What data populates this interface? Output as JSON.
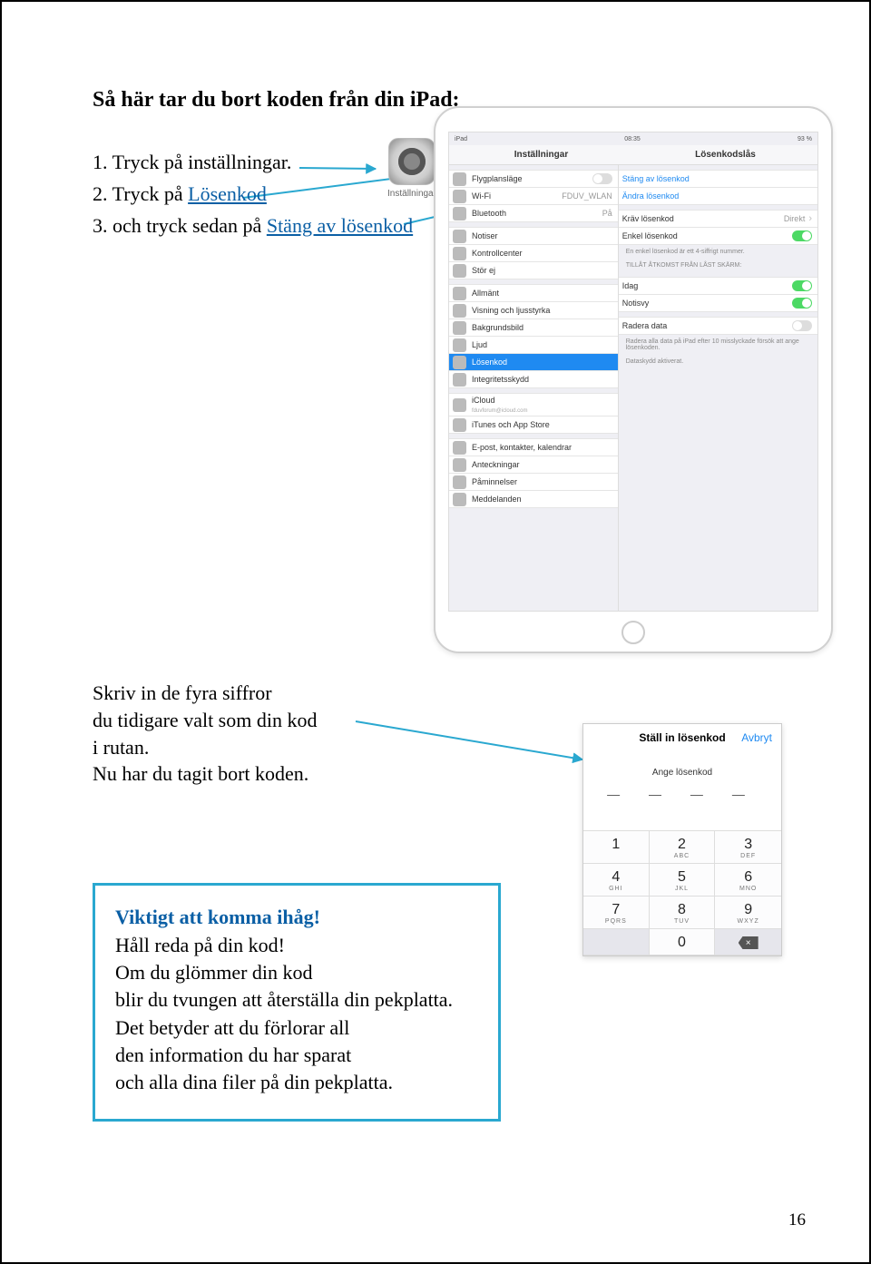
{
  "title": "Så här tar du bort koden från din iPad:",
  "steps": {
    "s1": "1. Tryck på inställningar.",
    "s2_prefix": "2. Tryck på ",
    "s2_link": "Lösenkod",
    "s3_prefix": "3. och tryck sedan på ",
    "s3_link": "Stäng av lösenkod"
  },
  "settings_icon_label": "Inställningar",
  "block2": {
    "l1": "Skriv in de fyra siffror",
    "l2": "du tidigare valt som din kod",
    "l3": "i rutan.",
    "l4": "Nu har du tagit bort koden."
  },
  "important": {
    "hdr": "Viktigt att komma ihåg!",
    "l1": "Håll reda på din kod!",
    "l2": "Om du glömmer din kod",
    "l3": "blir du tvungen att återställa din pekplatta.",
    "l4": "Det betyder att du förlorar all",
    "l5": "den information du har sparat",
    "l6": "och alla dina filer på din pekplatta."
  },
  "page_number": "16",
  "ipad": {
    "status": {
      "left": "iPad",
      "center": "08:35",
      "right": "93 %"
    },
    "titles": {
      "left": "Inställningar",
      "right": "Lösenkodslås"
    },
    "left_col": {
      "g1": [
        {
          "label": "Flygplansläge",
          "icon": "i-orange",
          "switch": "off"
        },
        {
          "label": "Wi-Fi",
          "icon": "i-blue",
          "value": "FDUV_WLAN"
        },
        {
          "label": "Bluetooth",
          "icon": "i-blue",
          "value": "På"
        }
      ],
      "g2": [
        {
          "label": "Notiser",
          "icon": "i-red"
        },
        {
          "label": "Kontrollcenter",
          "icon": "i-gray"
        },
        {
          "label": "Stör ej",
          "icon": "i-purple"
        }
      ],
      "g3": [
        {
          "label": "Allmänt",
          "icon": "i-gray"
        },
        {
          "label": "Visning och ljusstyrka",
          "icon": "i-bluel"
        },
        {
          "label": "Bakgrundsbild",
          "icon": "i-bluel"
        },
        {
          "label": "Ljud",
          "icon": "i-red"
        },
        {
          "label": "Lösenkod",
          "icon": "i-red",
          "selected": true
        },
        {
          "label": "Integritetsskydd",
          "icon": "i-gray"
        }
      ],
      "g4": [
        {
          "label": "iCloud",
          "icon": "i-blue",
          "sub": "fduvforum@icloud.com"
        },
        {
          "label": "iTunes och App Store",
          "icon": "i-blue"
        }
      ],
      "g5": [
        {
          "label": "E-post, kontakter, kalendrar",
          "icon": "i-blue"
        },
        {
          "label": "Anteckningar",
          "icon": "i-orange"
        },
        {
          "label": "Påminnelser",
          "icon": "i-gray"
        },
        {
          "label": "Meddelanden",
          "icon": "i-green"
        }
      ]
    },
    "right_col": {
      "g1": [
        {
          "label": "Stäng av lösenkod",
          "link": true
        },
        {
          "label": "Ändra lösenkod",
          "link": true
        }
      ],
      "g2": [
        {
          "label": "Kräv lösenkod",
          "value": "Direkt",
          "chev": true
        },
        {
          "label": "Enkel lösenkod",
          "switch": "on"
        }
      ],
      "g2_caption": "En enkel lösenkod är ett 4-siffrigt nummer.",
      "section_hdr": "TILLÅT ÅTKOMST FRÅN LÅST SKÄRM:",
      "g3": [
        {
          "label": "Idag",
          "switch": "on"
        },
        {
          "label": "Notisvy",
          "switch": "on"
        }
      ],
      "g4": [
        {
          "label": "Radera data",
          "switch": "off"
        }
      ],
      "g4_caption": "Radera alla data på iPad efter 10 misslyckade försök att ange lösenkoden.",
      "g4_caption2": "Dataskydd aktiverat."
    }
  },
  "dialog": {
    "title": "Ställ in lösenkod",
    "cancel": "Avbryt",
    "prompt": "Ange lösenkod",
    "dashes": "— — — —",
    "keys": [
      {
        "n": "1",
        "l": ""
      },
      {
        "n": "2",
        "l": "ABC"
      },
      {
        "n": "3",
        "l": "DEF"
      },
      {
        "n": "4",
        "l": "GHI"
      },
      {
        "n": "5",
        "l": "JKL"
      },
      {
        "n": "6",
        "l": "MNO"
      },
      {
        "n": "7",
        "l": "PQRS"
      },
      {
        "n": "8",
        "l": "TUV"
      },
      {
        "n": "9",
        "l": "WXYZ"
      }
    ]
  }
}
